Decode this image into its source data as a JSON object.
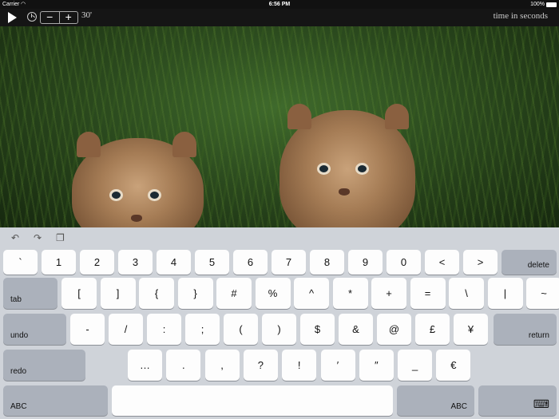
{
  "status_bar": {
    "carrier": "Carrier",
    "wifi": "wifi-icon",
    "time": "6:56 PM",
    "battery": "100%"
  },
  "toolbar": {
    "play": "play-icon",
    "timer": "timer-icon",
    "minus": "−",
    "plus": "+",
    "duration": "30'",
    "caption": "time in seconds"
  },
  "photo": {
    "subject": "two lynx kittens in grass"
  },
  "keyboard": {
    "top_icons": [
      "undo-icon",
      "redo-icon",
      "paste-icon"
    ],
    "row1": [
      "`",
      "1",
      "2",
      "3",
      "4",
      "5",
      "6",
      "7",
      "8",
      "9",
      "0",
      "<",
      ">"
    ],
    "delete": "delete",
    "tab": "tab",
    "row2": [
      "[",
      "]",
      "{",
      "}",
      "#",
      "%",
      "^",
      "*",
      "+",
      "=",
      "\\",
      "|",
      "~"
    ],
    "undo": "undo",
    "row3": [
      "-",
      "/",
      ":",
      ";",
      "(",
      ")",
      "$",
      "&",
      "@",
      "£",
      "¥"
    ],
    "return": "return",
    "redo": "redo",
    "row4": [
      "…",
      ".",
      ",",
      "?",
      "!",
      "′",
      "″",
      "_",
      "€"
    ],
    "abc_left": "ABC",
    "space": "",
    "abc_right": "ABC",
    "dismiss": "keyboard-dismiss-icon"
  }
}
